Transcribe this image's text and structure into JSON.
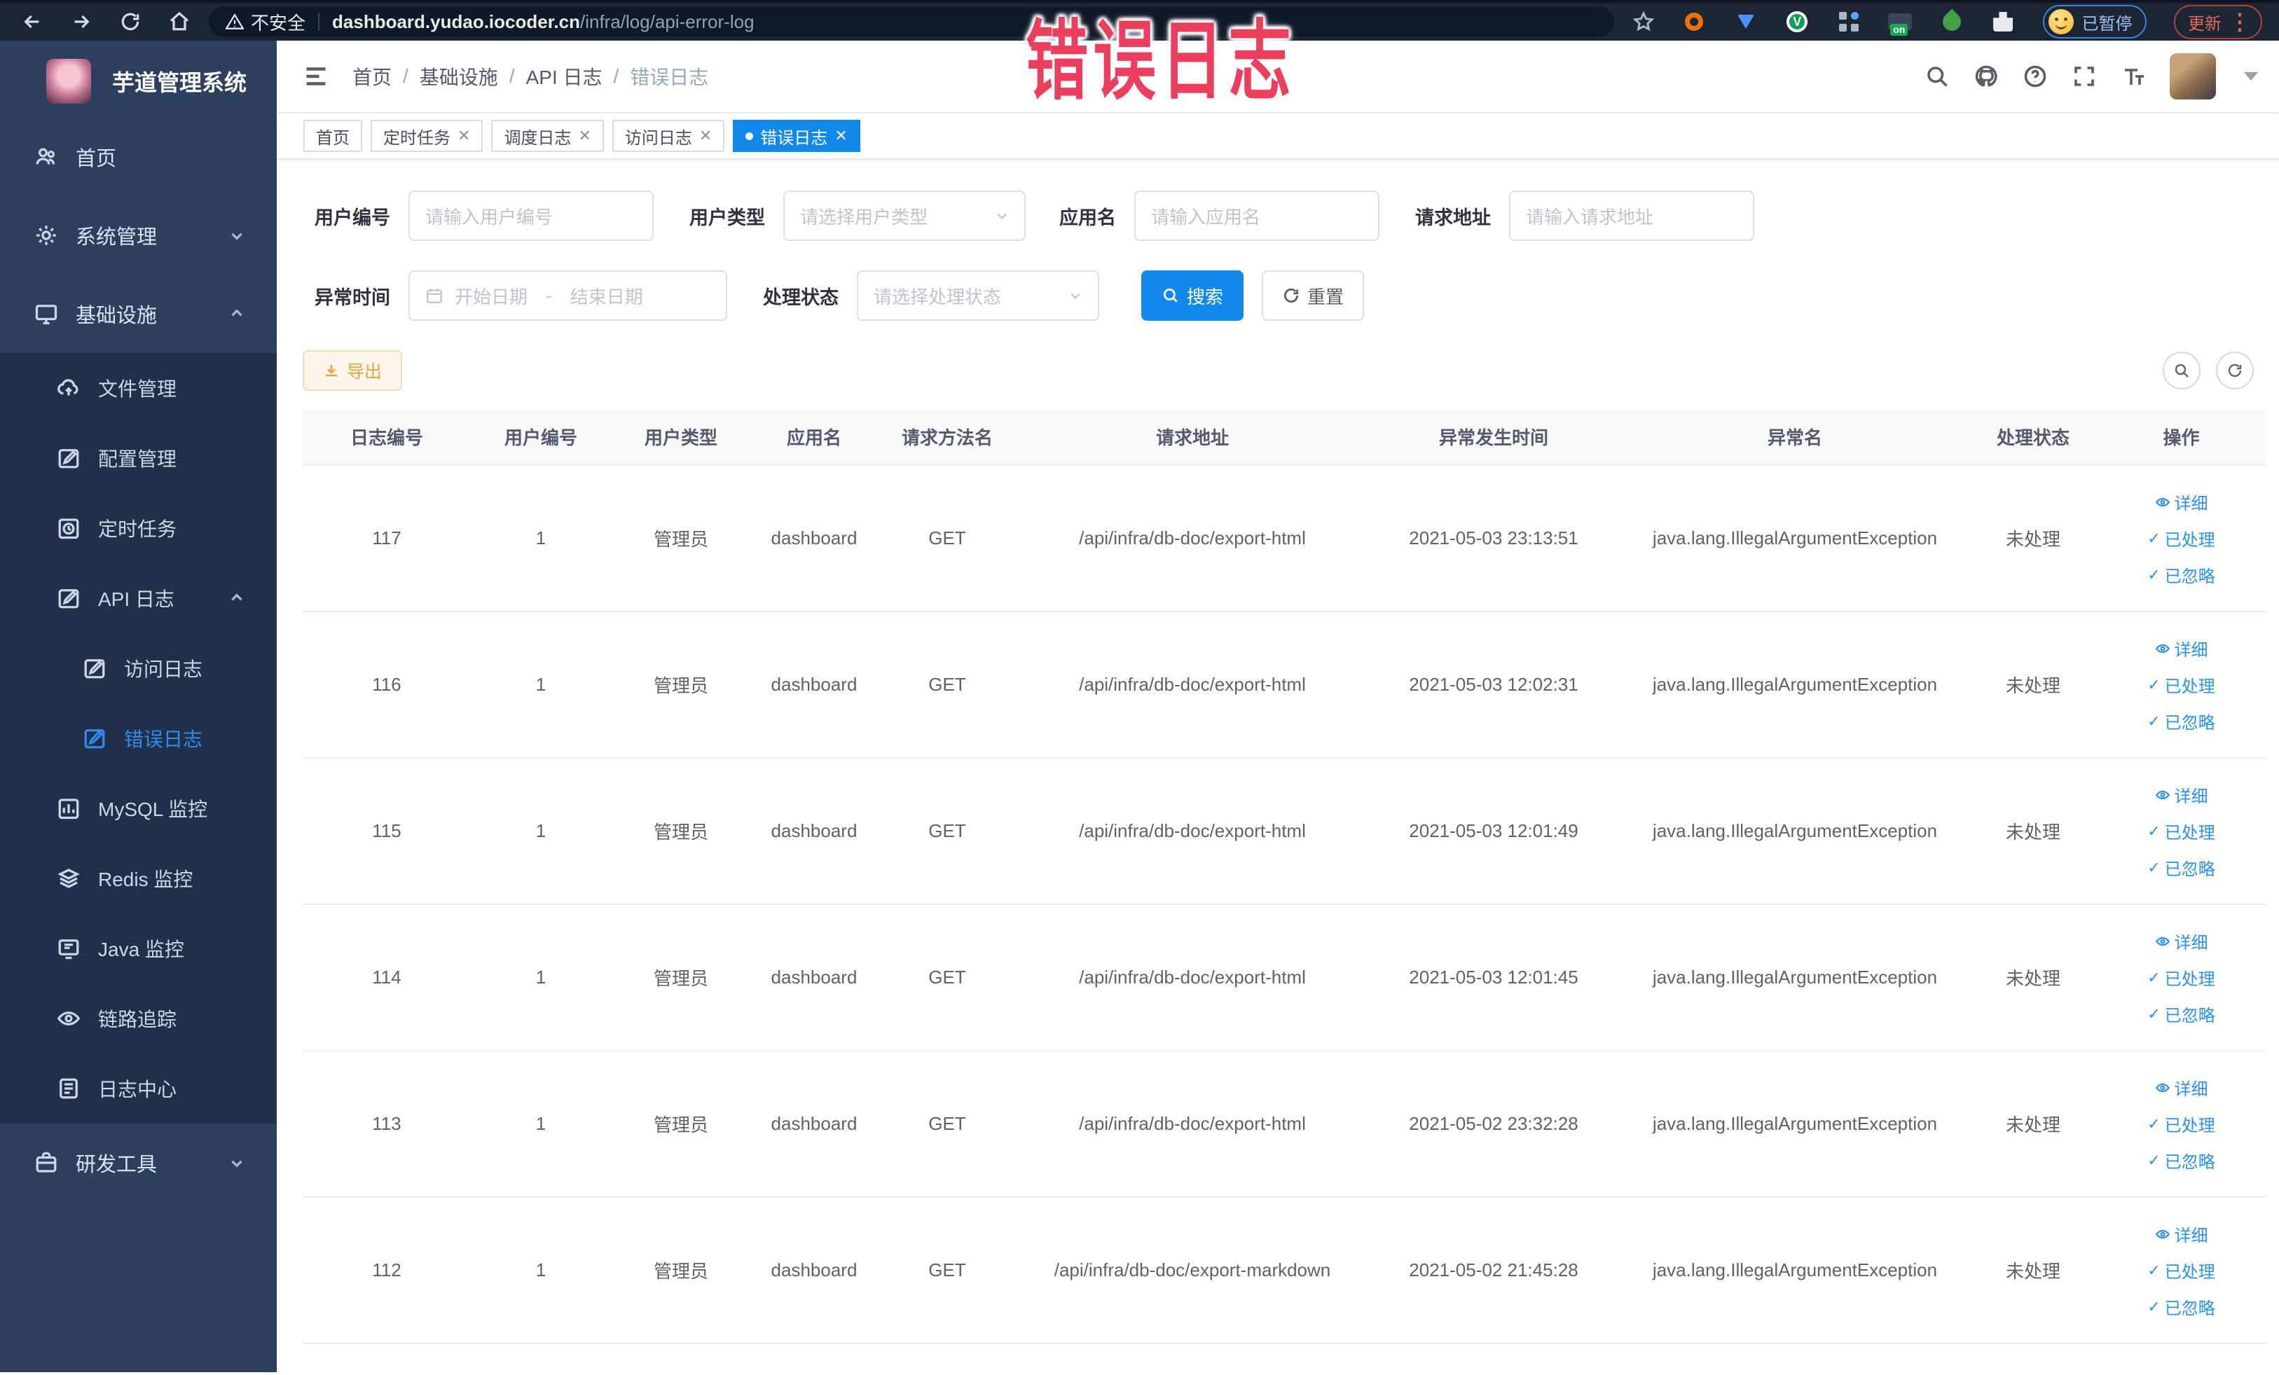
{
  "browser": {
    "not_secure": "不安全",
    "url_host": "dashboard.yudao.iocoder.cn",
    "url_path": "/infra/log/api-error-log",
    "paused_label": "已暂停",
    "update_label": "更新"
  },
  "overlay": {
    "text": "错误日志"
  },
  "sidebar": {
    "title": "芋道管理系统",
    "menu": [
      {
        "label": "首页",
        "icon": "people",
        "level": 0
      },
      {
        "label": "系统管理",
        "icon": "gear",
        "level": 0,
        "chevron": "down"
      },
      {
        "label": "基础设施",
        "icon": "monitor",
        "level": 0,
        "chevron": "up"
      },
      {
        "label": "文件管理",
        "icon": "cloud",
        "level": 1
      },
      {
        "label": "配置管理",
        "icon": "edit",
        "level": 1
      },
      {
        "label": "定时任务",
        "icon": "schedule",
        "level": 1
      },
      {
        "label": "API 日志",
        "icon": "logdoc",
        "level": 1,
        "chevron": "up"
      },
      {
        "label": "访问日志",
        "icon": "logdoc",
        "level": 2
      },
      {
        "label": "错误日志",
        "icon": "logdoc",
        "level": 2,
        "active": true
      },
      {
        "label": "MySQL 监控",
        "icon": "chart",
        "level": 1
      },
      {
        "label": "Redis 监控",
        "icon": "layers",
        "level": 1
      },
      {
        "label": "Java 监控",
        "icon": "java",
        "level": 1
      },
      {
        "label": "链路追踪",
        "icon": "eye",
        "level": 1
      },
      {
        "label": "日志中心",
        "icon": "doc",
        "level": 1
      },
      {
        "label": "研发工具",
        "icon": "tool",
        "level": 0,
        "chevron": "down"
      }
    ]
  },
  "navbar": {
    "breadcrumb": [
      "首页",
      "基础设施",
      "API 日志",
      "错误日志"
    ]
  },
  "tabs": [
    {
      "label": "首页",
      "closable": false,
      "active": false
    },
    {
      "label": "定时任务",
      "closable": true,
      "active": false
    },
    {
      "label": "调度日志",
      "closable": true,
      "active": false
    },
    {
      "label": "访问日志",
      "closable": true,
      "active": false
    },
    {
      "label": "错误日志",
      "closable": true,
      "active": true
    }
  ],
  "filters": {
    "user_id": {
      "label": "用户编号",
      "placeholder": "请输入用户编号"
    },
    "user_type": {
      "label": "用户类型",
      "placeholder": "请选择用户类型"
    },
    "app_name": {
      "label": "应用名",
      "placeholder": "请输入应用名"
    },
    "request_url": {
      "label": "请求地址",
      "placeholder": "请输入请求地址"
    },
    "exception_time": {
      "label": "异常时间",
      "start": "开始日期",
      "separator": "-",
      "end": "结束日期"
    },
    "process_status": {
      "label": "处理状态",
      "placeholder": "请选择处理状态"
    },
    "search_label": "搜索",
    "reset_label": "重置"
  },
  "toolbar": {
    "export_label": "导出"
  },
  "table": {
    "columns": [
      "日志编号",
      "用户编号",
      "用户类型",
      "应用名",
      "请求方法名",
      "请求地址",
      "异常发生时间",
      "异常名",
      "处理状态",
      "操作"
    ],
    "ops": [
      "详细",
      "已处理",
      "已忽略"
    ],
    "rows": [
      {
        "id": "117",
        "user": "1",
        "type": "管理员",
        "app": "dashboard",
        "method": "GET",
        "url": "/api/infra/db-doc/export-html",
        "time": "2021-05-03 23:13:51",
        "exception": "java.lang.IllegalArgumentException",
        "status": "未处理"
      },
      {
        "id": "116",
        "user": "1",
        "type": "管理员",
        "app": "dashboard",
        "method": "GET",
        "url": "/api/infra/db-doc/export-html",
        "time": "2021-05-03 12:02:31",
        "exception": "java.lang.IllegalArgumentException",
        "status": "未处理"
      },
      {
        "id": "115",
        "user": "1",
        "type": "管理员",
        "app": "dashboard",
        "method": "GET",
        "url": "/api/infra/db-doc/export-html",
        "time": "2021-05-03 12:01:49",
        "exception": "java.lang.IllegalArgumentException",
        "status": "未处理"
      },
      {
        "id": "114",
        "user": "1",
        "type": "管理员",
        "app": "dashboard",
        "method": "GET",
        "url": "/api/infra/db-doc/export-html",
        "time": "2021-05-03 12:01:45",
        "exception": "java.lang.IllegalArgumentException",
        "status": "未处理"
      },
      {
        "id": "113",
        "user": "1",
        "type": "管理员",
        "app": "dashboard",
        "method": "GET",
        "url": "/api/infra/db-doc/export-html",
        "time": "2021-05-02 23:32:28",
        "exception": "java.lang.IllegalArgumentException",
        "status": "未处理"
      },
      {
        "id": "112",
        "user": "1",
        "type": "管理员",
        "app": "dashboard",
        "method": "GET",
        "url": "/api/infra/db-doc/export-markdown",
        "time": "2021-05-02 21:45:28",
        "exception": "java.lang.IllegalArgumentException",
        "status": "未处理"
      }
    ]
  }
}
